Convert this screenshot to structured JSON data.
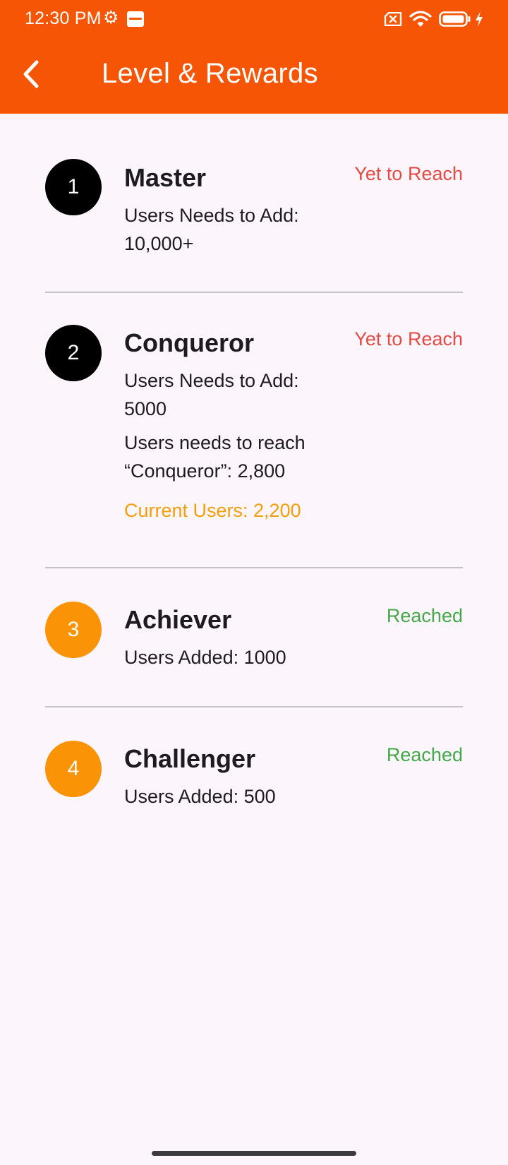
{
  "status_bar": {
    "time": "12:30 PM",
    "icons": [
      "gear-icon",
      "app-notification-icon",
      "no-sim-icon",
      "wifi-icon",
      "battery-icon",
      "charging-bolt-icon"
    ]
  },
  "app_bar": {
    "title": "Level & Rewards",
    "back_icon": "chevron-left-icon"
  },
  "colors": {
    "app_bar": "#f55505",
    "background": "#fcf5fc",
    "badge_pending": "#000000",
    "badge_reached": "#fb9306",
    "status_pending": "#e24c44",
    "status_reached": "#45a84a",
    "current_users": "#f59e0c"
  },
  "levels": [
    {
      "number": "1",
      "name": "Master",
      "status": "Yet to Reach",
      "lines": [
        "Users Needs to Add:",
        "10,000+"
      ]
    },
    {
      "number": "2",
      "name": "Conqueror",
      "status": "Yet to Reach",
      "lines": [
        "Users Needs to Add:",
        "5000",
        "Users needs to reach",
        "“Conqueror”: 2,800"
      ],
      "current_users": "Current Users: 2,200"
    },
    {
      "number": "3",
      "name": "Achiever",
      "status": "Reached",
      "lines": [
        "Users Added: 1000"
      ]
    },
    {
      "number": "4",
      "name": "Challenger",
      "status": "Reached",
      "lines": [
        "Users Added: 500"
      ]
    }
  ]
}
